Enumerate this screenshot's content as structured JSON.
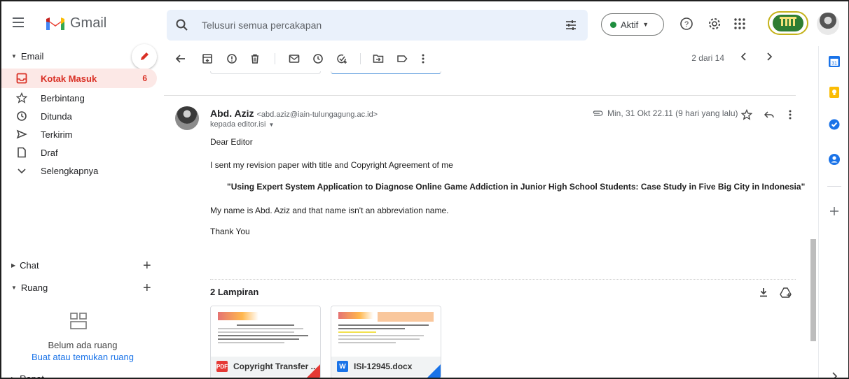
{
  "header": {
    "app_name": "Gmail",
    "search_placeholder": "Telusuri semua percakapan",
    "status_label": "Aktif",
    "org_logo_text": "Ĩ"
  },
  "nav": {
    "section_email": "Email",
    "items": [
      {
        "label": "Kotak Masuk",
        "count": "6",
        "icon": "inbox-icon"
      },
      {
        "label": "Berbintang",
        "icon": "star-icon"
      },
      {
        "label": "Ditunda",
        "icon": "clock-icon"
      },
      {
        "label": "Terkirim",
        "icon": "send-icon"
      },
      {
        "label": "Draf",
        "icon": "draft-icon"
      },
      {
        "label": "Selengkapnya",
        "icon": "chevron-down-icon"
      }
    ],
    "section_chat": "Chat",
    "section_rooms": "Ruang",
    "rooms_empty_text": "Belum ada ruang",
    "rooms_link": "Buat atau temukan ruang",
    "section_meet": "Rapat"
  },
  "toolbar": {
    "pager_text": "2 dari 14"
  },
  "message": {
    "sender_name": "Abd. Aziz",
    "sender_email": "<abd.aziz@iain-tulungagung.ac.id>",
    "to_text": "kepada editor.isi",
    "date_text": "Min, 31 Okt 22.11 (9 hari yang lalu)",
    "body": {
      "greeting": "Dear Editor",
      "line1": "I sent my revision paper with title and Copyright Agreement of me",
      "title": "\"Using Expert System Application to Diagnose Online Game Addiction in Junior High School Students: Case Study in Five Big City in Indonesia\"",
      "line2": "My name is Abd. Aziz and that name isn't an abbreviation name.",
      "closing": "Thank You"
    }
  },
  "attachments": {
    "header": "2 Lampiran",
    "items": [
      {
        "name": "Copyright Transfer ...",
        "type": "PDF",
        "color": "#e53935"
      },
      {
        "name": "ISI-12945.docx",
        "type": "W",
        "color": "#1a73e8"
      }
    ]
  },
  "colors": {
    "active_bg": "#fce8e6",
    "active_text": "#d93025",
    "link": "#1a73e8",
    "status_green": "#1e8e3e"
  }
}
